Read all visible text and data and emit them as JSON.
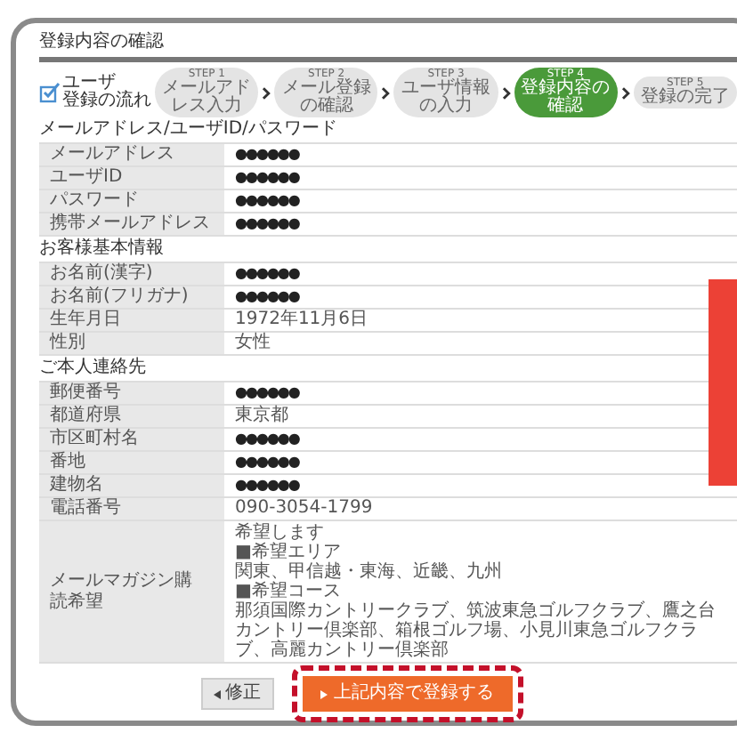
{
  "page_title": "登録内容の確認",
  "flow": {
    "label_lines": [
      "ユーザ",
      "登録の流れ"
    ],
    "steps": [
      {
        "step": "STEP 1",
        "label": "メールアドレス入力",
        "selected": false
      },
      {
        "step": "STEP 2",
        "label": "メール登録の確認",
        "selected": false
      },
      {
        "step": "STEP 3",
        "label": "ユーザ情報の入力",
        "selected": false
      },
      {
        "step": "STEP 4",
        "label": "登録内容の確認",
        "selected": true
      },
      {
        "step": "STEP 5",
        "label": "登録の完了",
        "selected": false
      }
    ]
  },
  "sections": [
    {
      "heading": "メールアドレス/ユーザID/パスワード",
      "rows": [
        {
          "label": "メールアドレス",
          "value": "●●●●●●",
          "kind": "masked"
        },
        {
          "label": "ユーザID",
          "value": "●●●●●●",
          "kind": "masked"
        },
        {
          "label": "パスワード",
          "value": "●●●●●●",
          "kind": "masked"
        },
        {
          "label": "携帯メールアドレス",
          "value": "●●●●●●",
          "kind": "masked"
        }
      ]
    },
    {
      "heading": "お客様基本情報",
      "rows": [
        {
          "label": "お名前(漢字)",
          "value": "●●●●●●",
          "kind": "masked"
        },
        {
          "label": "お名前(フリガナ)",
          "value": "●●●●●●",
          "kind": "masked"
        },
        {
          "label": "生年月日",
          "value": "1972年11月6日",
          "kind": "plain"
        },
        {
          "label": "性別",
          "value": "女性",
          "kind": "plain"
        }
      ]
    },
    {
      "heading": "ご本人連絡先",
      "rows": [
        {
          "label": "郵便番号",
          "value": "●●●●●●",
          "kind": "masked"
        },
        {
          "label": "都道府県",
          "value": "東京都",
          "kind": "plain"
        },
        {
          "label": "市区町村名",
          "value": "●●●●●●",
          "kind": "masked"
        },
        {
          "label": "番地",
          "value": "●●●●●●",
          "kind": "masked"
        },
        {
          "label": "建物名",
          "value": "●●●●●●",
          "kind": "masked"
        },
        {
          "label": "電話番号",
          "value": "090-3054-1799",
          "kind": "plain"
        },
        {
          "label": "メールマガジン購読希望",
          "lines": [
            "希望します",
            "■希望エリア",
            "関東、甲信越・東海、近畿、九州",
            "■希望コース",
            "那須国際カントリークラブ、筑波東急ゴルフクラブ、鷹之台カントリー倶楽部、箱根ゴルフ場、小見川東急ゴルフクラブ、高麗カントリー倶楽部"
          ],
          "kind": "multiline"
        }
      ]
    }
  ],
  "buttons": [
    {
      "label": "修正",
      "kind": "back"
    },
    {
      "label": "上記内容で登録する",
      "kind": "submit"
    }
  ]
}
